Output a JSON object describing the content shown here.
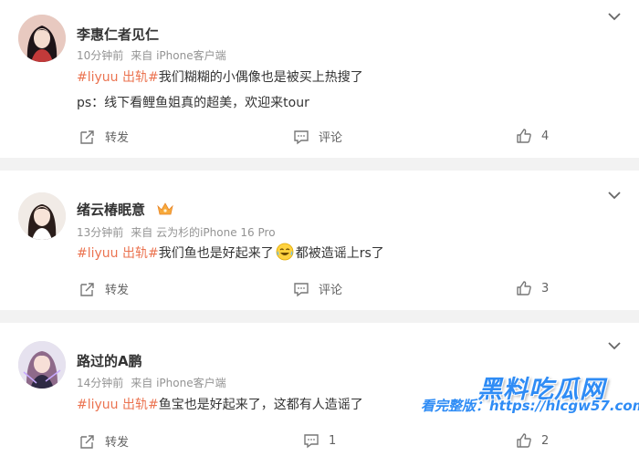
{
  "posts": [
    {
      "user": "李惠仁者见仁",
      "time": "10分钟前",
      "source": "来自 iPhone客户端",
      "tag": "#liyuu 出轨#",
      "text": "我们糊糊的小偶像也是被买上热搜了",
      "text2": "ps：线下看鲤鱼姐真的超美，欢迎来tour",
      "repost_label": "转发",
      "comment_label": "评论",
      "like_count": "4"
    },
    {
      "user": "绪云椿眠意",
      "time": "13分钟前",
      "source": "来自 云为杉的iPhone 16 Pro",
      "tag": "#liyuu 出轨#",
      "text": "我们鱼也是好起来了",
      "text_after_emoji": "都被造谣上rs了",
      "repost_label": "转发",
      "comment_label": "评论",
      "like_count": "3"
    },
    {
      "user": "路过的A鹏",
      "time": "14分钟前",
      "source": "来自 iPhone客户端",
      "tag": "#liyuu 出轨#",
      "text": "鱼宝也是好起来了，这都有人造谣了",
      "repost_label": "转发",
      "comment_count": "1",
      "like_count": "2"
    }
  ],
  "icons": {
    "repost": "repost-icon",
    "comment": "comment-icon",
    "like": "like-icon",
    "more": "chevron-down-icon"
  },
  "watermark": {
    "title": "黑料吃瓜网",
    "subtitle": "看完整版：https://hlcgw57.com"
  },
  "colors": {
    "topic": "#eb7350",
    "watermark": "#2f8cf5",
    "background": "#f2f2f2"
  }
}
